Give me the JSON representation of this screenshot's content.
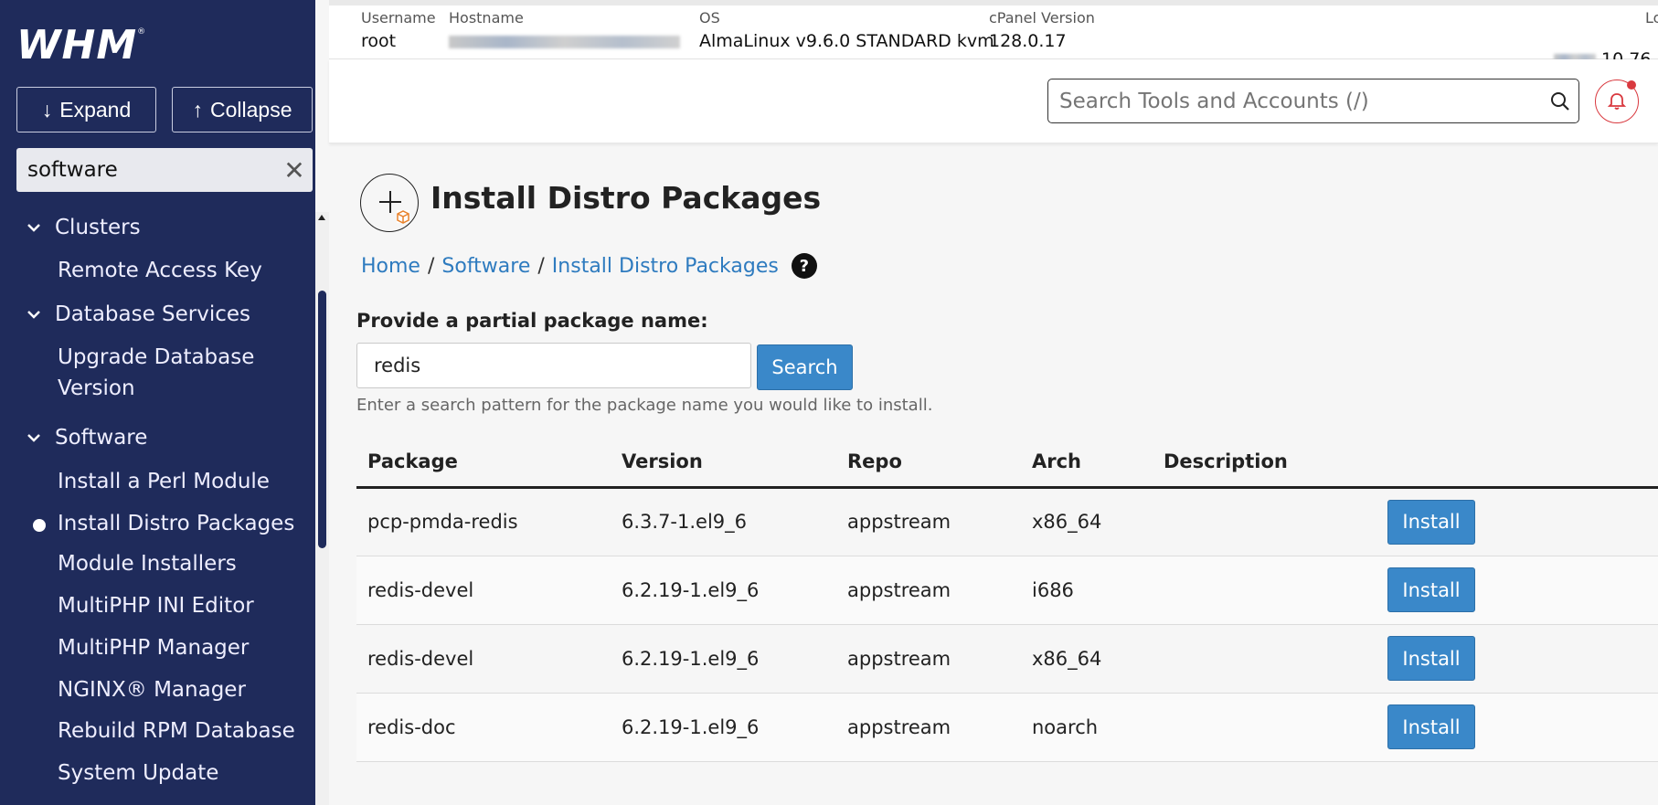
{
  "sidebar": {
    "logo": "WHM",
    "logo_mark": "®",
    "expand_label": "Expand",
    "collapse_label": "Collapse",
    "filter_value": "software",
    "items": [
      {
        "label": "Clusters",
        "type": "group"
      },
      {
        "label": "Remote Access Key",
        "type": "child"
      },
      {
        "label": "Database Services",
        "type": "group"
      },
      {
        "label": "Upgrade Database Version",
        "type": "child"
      },
      {
        "label": "Software",
        "type": "group"
      },
      {
        "label": "Install a Perl Module",
        "type": "child"
      },
      {
        "label": "Install Distro Packages",
        "type": "child",
        "active": true
      },
      {
        "label": "Module Installers",
        "type": "child"
      },
      {
        "label": "MultiPHP INI Editor",
        "type": "child"
      },
      {
        "label": "MultiPHP Manager",
        "type": "child"
      },
      {
        "label": "NGINX® Manager",
        "type": "child"
      },
      {
        "label": "Rebuild RPM Database",
        "type": "child"
      },
      {
        "label": "System Update",
        "type": "child"
      }
    ]
  },
  "topinfo": {
    "username_label": "Username",
    "username": "root",
    "hostname_label": "Hostname",
    "os_label": "OS",
    "os": "AlmaLinux v9.6.0 STANDARD kvm",
    "cpanel_label": "cPanel Version",
    "cpanel": "128.0.17",
    "load_label": "Load Av",
    "load": "10.76"
  },
  "header": {
    "search_placeholder": "Search Tools and Accounts (/)"
  },
  "page": {
    "title": "Install Distro Packages",
    "breadcrumbs": [
      "Home",
      "Software",
      "Install Distro Packages"
    ],
    "help_glyph": "?",
    "field_label": "Provide a partial package name:",
    "field_value": "redis",
    "search_button": "Search",
    "help_text": "Enter a search pattern for the package name you would like to install."
  },
  "table": {
    "headers": [
      "Package",
      "Version",
      "Repo",
      "Arch",
      "Description"
    ],
    "rows": [
      {
        "package": "pcp-pmda-redis",
        "version": "6.3.7-1.el9_6",
        "repo": "appstream",
        "arch": "x86_64",
        "description": "",
        "action": "Install"
      },
      {
        "package": "redis-devel",
        "version": "6.2.19-1.el9_6",
        "repo": "appstream",
        "arch": "i686",
        "description": "",
        "action": "Install"
      },
      {
        "package": "redis-devel",
        "version": "6.2.19-1.el9_6",
        "repo": "appstream",
        "arch": "x86_64",
        "description": "",
        "action": "Install"
      },
      {
        "package": "redis-doc",
        "version": "6.2.19-1.el9_6",
        "repo": "appstream",
        "arch": "noarch",
        "description": "",
        "action": "Install"
      }
    ]
  },
  "colors": {
    "sidebar_bg": "#1f2b5b",
    "accent_blue": "#3a88c9",
    "link_blue": "#2e7bbf",
    "alert_red": "#d9393f",
    "package_orange": "#e8822c"
  }
}
